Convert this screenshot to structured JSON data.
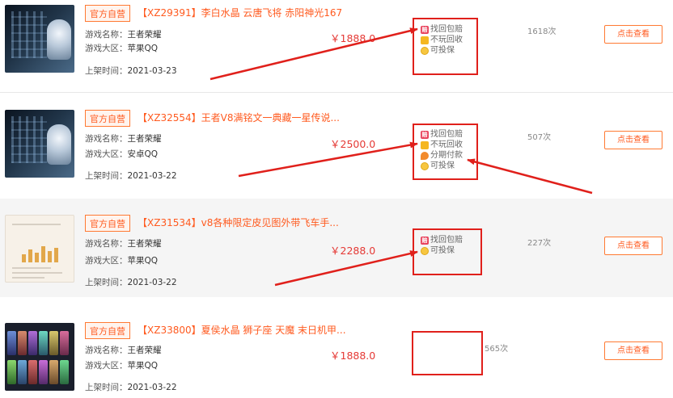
{
  "labels": {
    "official": "官方自营",
    "game_name": "游戏名称：",
    "game_region": "游戏大区：",
    "listed": "上架时间：",
    "view_button": "点击查看",
    "pei_glyph": "赔"
  },
  "listings": [
    {
      "title": "【XZ29391】李白水晶 云唐飞将 赤阳神光167",
      "game": "王者荣耀",
      "region": "苹果QQ",
      "date": "2021-03-23",
      "price": "￥1888.0",
      "features": [
        "找回包赔",
        "不玩回收",
        "可投保"
      ],
      "views": "1618次"
    },
    {
      "title": "【XZ32554】王者V8满铭文一典藏一星传说...",
      "game": "王者荣耀",
      "region": "安卓QQ",
      "date": "2021-03-22",
      "price": "￥2500.0",
      "features": [
        "找回包赔",
        "不玩回收",
        "分期付款",
        "可投保"
      ],
      "views": "507次"
    },
    {
      "title": "【XZ31534】v8各种限定皮见图外带飞车手...",
      "game": "王者荣耀",
      "region": "苹果QQ",
      "date": "2021-03-22",
      "price": "￥2288.0",
      "features": [
        "找回包赔",
        "可投保"
      ],
      "views": "227次"
    },
    {
      "title": "【XZ33800】夏侯水晶 狮子座 天魔 末日机甲...",
      "game": "王者荣耀",
      "region": "苹果QQ",
      "date": "2021-03-22",
      "price": "￥1888.0",
      "features": [],
      "views": "565次"
    }
  ],
  "colors": {
    "accent": "#ff5a1f",
    "price": "#e53935",
    "annotation": "#e0201b"
  }
}
